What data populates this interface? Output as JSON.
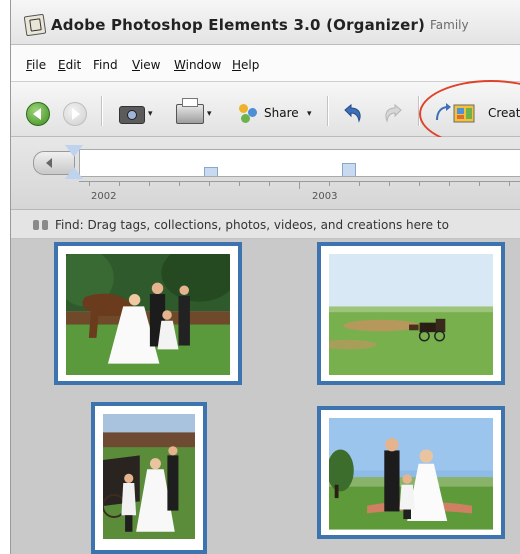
{
  "window": {
    "title": "Adobe Photoshop Elements 3.0 (Organizer)",
    "subtitle": "Family"
  },
  "menu": {
    "items": [
      {
        "label": "File",
        "underline": "F",
        "rest": "ile"
      },
      {
        "label": "Edit",
        "underline": "E",
        "rest": "dit"
      },
      {
        "label": "Find",
        "underline": "",
        "rest": "Find"
      },
      {
        "label": "View",
        "underline": "V",
        "rest": "iew"
      },
      {
        "label": "Window",
        "underline": "W",
        "rest": "indow"
      },
      {
        "label": "Help",
        "underline": "H",
        "rest": "elp"
      }
    ]
  },
  "toolbar": {
    "share_label": "Share",
    "create_label": "Create",
    "caret": "▾",
    "icons": [
      "back-icon",
      "forward-icon",
      "camera-icon",
      "print-icon",
      "share-icon",
      "undo-icon",
      "redo-icon",
      "create-icon"
    ]
  },
  "timeline": {
    "years": [
      "2002",
      "2003"
    ]
  },
  "findbar": {
    "text": "Find: Drag tags, collections, photos, videos, and creations here to"
  },
  "photos": [
    {
      "name": "wedding-horse-photo"
    },
    {
      "name": "carriage-field-photo"
    },
    {
      "name": "wedding-carriage-photo"
    },
    {
      "name": "wedding-couple-photo"
    }
  ],
  "colors": {
    "accent": "#3d74b0",
    "highlight": "#e0432c"
  }
}
